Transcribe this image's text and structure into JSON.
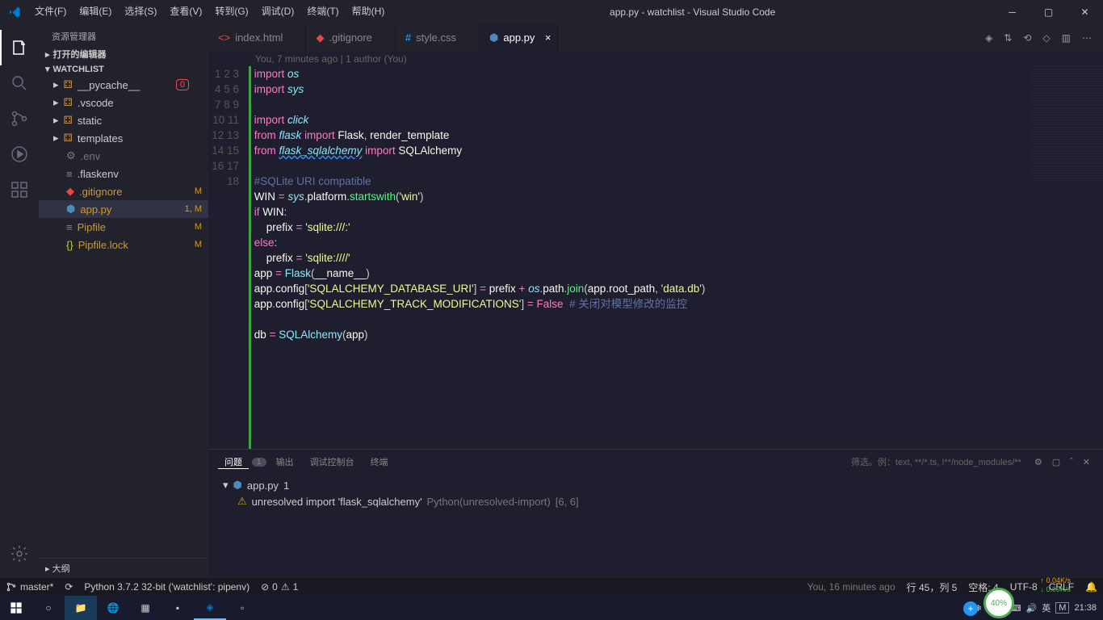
{
  "title": "app.py - watchlist - Visual Studio Code",
  "menu": [
    "文件(F)",
    "编辑(E)",
    "选择(S)",
    "查看(V)",
    "转到(G)",
    "调试(D)",
    "终端(T)",
    "帮助(H)"
  ],
  "sidebar": {
    "title": "资源管理器",
    "openEditors": "打开的编辑器",
    "folder": "WATCHLIST",
    "items": [
      {
        "name": "__pycache__",
        "icon": "folder",
        "badge": ""
      },
      {
        "name": ".vscode",
        "icon": "folder",
        "badge": ""
      },
      {
        "name": "static",
        "icon": "folder",
        "badge": ""
      },
      {
        "name": "templates",
        "icon": "folder",
        "badge": ""
      },
      {
        "name": ".env",
        "icon": "gear",
        "badge": ""
      },
      {
        "name": ".flaskenv",
        "icon": "file",
        "badge": ""
      },
      {
        "name": ".gitignore",
        "icon": "git",
        "badge": "M"
      },
      {
        "name": "app.py",
        "icon": "python",
        "badge": "1, M",
        "active": true
      },
      {
        "name": "Pipfile",
        "icon": "file",
        "badge": "M"
      },
      {
        "name": "Pipfile.lock",
        "icon": "json",
        "badge": "M"
      }
    ],
    "outline": "大纲",
    "errBadge": "0"
  },
  "tabs": [
    {
      "label": "index.html",
      "icon": "html"
    },
    {
      "label": ".gitignore",
      "icon": "git"
    },
    {
      "label": "style.css",
      "icon": "css"
    },
    {
      "label": "app.py",
      "icon": "python",
      "active": true,
      "close": true
    }
  ],
  "blame": "You, 7 minutes ago | 1 author (You)",
  "code": {
    "lines": [
      1,
      2,
      3,
      4,
      5,
      6,
      7,
      8,
      9,
      10,
      11,
      12,
      13,
      14,
      15,
      16,
      17,
      18
    ]
  },
  "panel": {
    "tabs": {
      "problems": "问题",
      "count": "1",
      "output": "输出",
      "debug": "调试控制台",
      "terminal": "终端"
    },
    "filter": "筛选。例：text, **/*.ts, !**/node_modules/**",
    "file": "app.py",
    "fileCount": "1",
    "problem": "unresolved import 'flask_sqlalchemy'",
    "problemSrc": "Python(unresolved-import)",
    "problemLoc": "[6, 6]"
  },
  "status": {
    "branch": "master*",
    "sync": "",
    "python": "Python 3.7.2 32-bit ('watchlist': pipenv)",
    "errors": "0",
    "warnings": "1",
    "blame": "You, 16 minutes ago",
    "ln": "行 45，列 5",
    "spaces": "空格: 4",
    "encoding": "UTF-8",
    "eol": "CRLF",
    "bell": ""
  },
  "taskbar": {
    "time": "21:38",
    "date": "",
    "ime": "英",
    "m": "M",
    "perf": "40%",
    "up": "0.04K/s",
    "dn": "0.09K/s"
  }
}
